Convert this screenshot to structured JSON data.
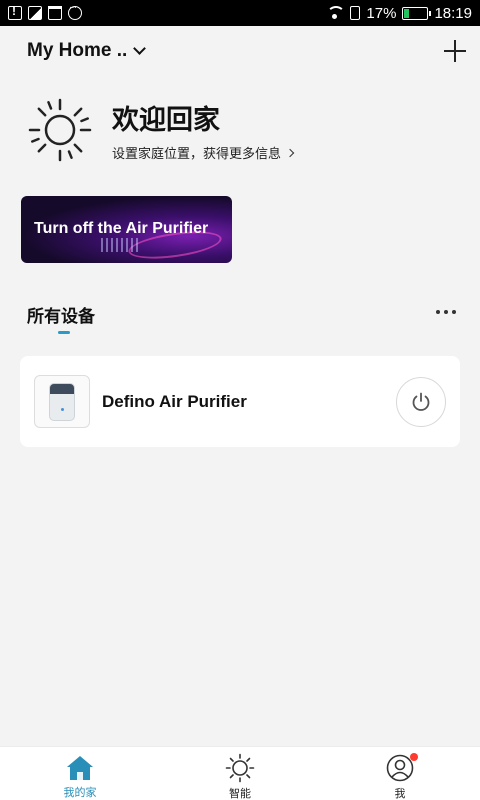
{
  "status_bar": {
    "battery_percent": "17%",
    "battery_level": 0.17,
    "time": "18:19",
    "battery_color": "#22c55e"
  },
  "header": {
    "home_name": "My Home ..",
    "add_icon": "plus-icon"
  },
  "welcome": {
    "title": "欢迎回家",
    "subtitle": "设置家庭位置，获得更多信息"
  },
  "banner": {
    "text": "Turn off the Air Purifier"
  },
  "devices_section": {
    "title": "所有设备",
    "accent_color": "#2a9bc7"
  },
  "devices": [
    {
      "name": "Defino Air Purifier",
      "icon": "air-purifier-icon",
      "power_icon": "power-icon"
    }
  ],
  "bottom_nav": {
    "items": [
      {
        "label": "我的家",
        "icon": "home-icon",
        "active": true
      },
      {
        "label": "智能",
        "icon": "sun-icon",
        "active": false
      },
      {
        "label": "我",
        "icon": "user-icon",
        "active": false,
        "notification_dot": true
      }
    ],
    "active_color": "#2a8fb8"
  }
}
